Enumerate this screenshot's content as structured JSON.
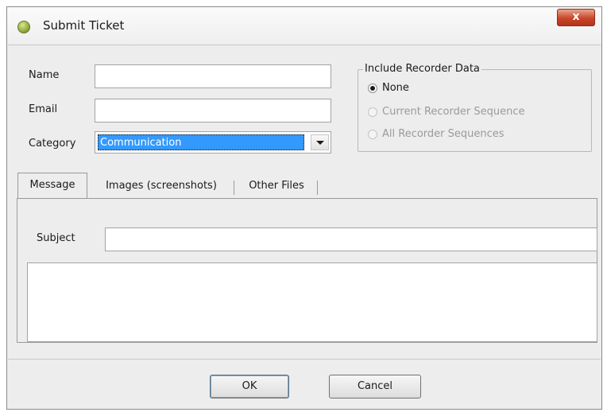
{
  "window": {
    "title": "Submit Ticket",
    "close_glyph": "x"
  },
  "form": {
    "name_label": "Name",
    "name_value": "",
    "email_label": "Email",
    "email_value": "",
    "category_label": "Category",
    "category_value": "Communication"
  },
  "recorder_group": {
    "legend": "Include Recorder Data",
    "options": [
      {
        "label": "None",
        "checked": true,
        "enabled": true
      },
      {
        "label": "Current Recorder Sequence",
        "checked": false,
        "enabled": false
      },
      {
        "label": "All Recorder Sequences",
        "checked": false,
        "enabled": false
      }
    ]
  },
  "tabs": [
    {
      "label": "Message",
      "active": true
    },
    {
      "label": "Images (screenshots)",
      "active": false
    },
    {
      "label": "Other Files",
      "active": false
    }
  ],
  "message": {
    "subject_label": "Subject",
    "subject_value": "",
    "body_value": ""
  },
  "buttons": {
    "ok_label": "OK",
    "cancel_label": "Cancel"
  },
  "icons": {
    "app": "green-orb-icon",
    "close": "close-icon",
    "dropdown": "chevron-down-icon"
  }
}
